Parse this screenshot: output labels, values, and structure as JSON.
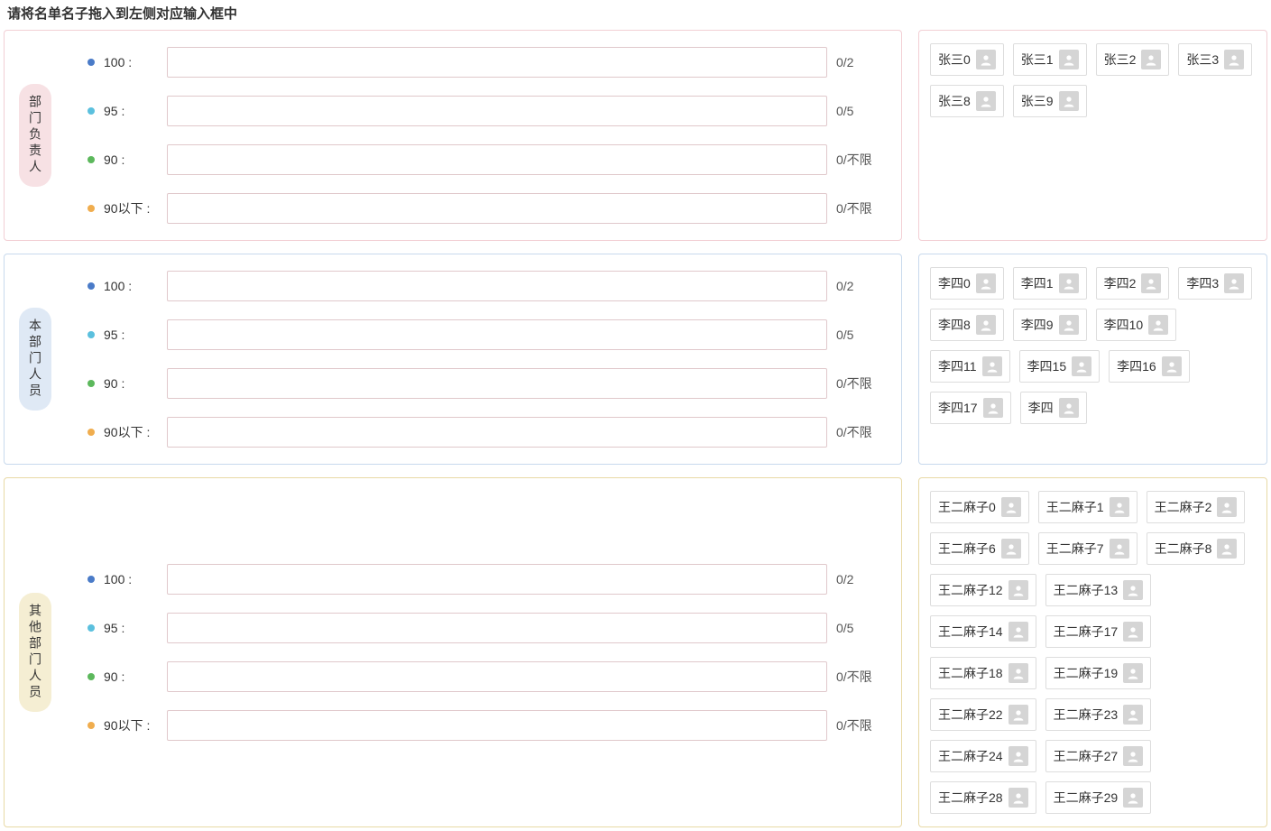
{
  "page_title": "请将名单名子拖入到左侧对应输入框中",
  "sections": [
    {
      "key": "dept_leader",
      "label": "部门负责人",
      "border_class": "border-pink",
      "vlabel_class": "vlabel-pink",
      "rows": [
        {
          "dot": "dot-blue",
          "label": "100 :",
          "counter": "0/2"
        },
        {
          "dot": "dot-cyan",
          "label": "95 :",
          "counter": "0/5"
        },
        {
          "dot": "dot-green",
          "label": "90 :",
          "counter": "0/不限"
        },
        {
          "dot": "dot-orange",
          "label": "90以下 :",
          "counter": "0/不限"
        }
      ],
      "people": [
        "张三0",
        "张三1",
        "张三2",
        "张三3",
        "张三8",
        "张三9"
      ]
    },
    {
      "key": "own_dept",
      "label": "本部门人员",
      "border_class": "border-blue",
      "vlabel_class": "vlabel-blue",
      "rows": [
        {
          "dot": "dot-blue",
          "label": "100 :",
          "counter": "0/2"
        },
        {
          "dot": "dot-cyan",
          "label": "95 :",
          "counter": "0/5"
        },
        {
          "dot": "dot-green",
          "label": "90 :",
          "counter": "0/不限"
        },
        {
          "dot": "dot-orange",
          "label": "90以下 :",
          "counter": "0/不限"
        }
      ],
      "people": [
        "李四0",
        "李四1",
        "李四2",
        "李四3",
        "李四8",
        "李四9",
        "李四10",
        "李四11",
        "李四15",
        "李四16",
        "李四17",
        "李四"
      ]
    },
    {
      "key": "other_dept",
      "label": "其他部门人员",
      "border_class": "border-yellow",
      "vlabel_class": "vlabel-yellow",
      "rows": [
        {
          "dot": "dot-blue",
          "label": "100 :",
          "counter": "0/2"
        },
        {
          "dot": "dot-cyan",
          "label": "95 :",
          "counter": "0/5"
        },
        {
          "dot": "dot-green",
          "label": "90 :",
          "counter": "0/不限"
        },
        {
          "dot": "dot-orange",
          "label": "90以下 :",
          "counter": "0/不限"
        }
      ],
      "people": [
        "王二麻子0",
        "王二麻子1",
        "王二麻子2",
        "王二麻子6",
        "王二麻子7",
        "王二麻子8",
        "王二麻子12",
        "王二麻子13",
        "王二麻子14",
        "王二麻子17",
        "王二麻子18",
        "王二麻子19",
        "王二麻子22",
        "王二麻子23",
        "王二麻子24",
        "王二麻子27",
        "王二麻子28",
        "王二麻子29"
      ]
    }
  ]
}
